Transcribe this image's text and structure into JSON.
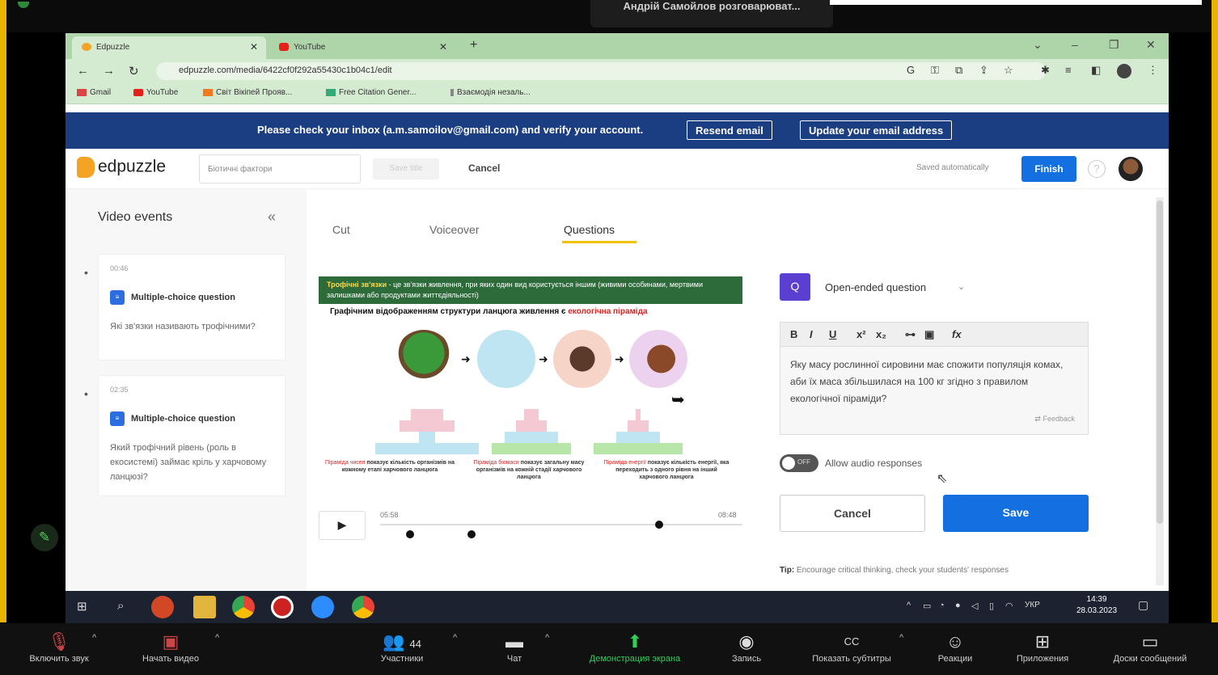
{
  "zoom_top": {
    "speaker": "Андрій Самойлов розговарюват..."
  },
  "browser": {
    "tabs": [
      {
        "label": "Edpuzzle"
      },
      {
        "label": "YouTube"
      }
    ],
    "url": "edpuzzle.com/media/6422cf0f292a55430c1b04c1/edit",
    "bookmarks": [
      "Gmail",
      "YouTube",
      "Світ Вікіпей Прояв...",
      "Free Citation Gener...",
      "Взаємодія незаль..."
    ]
  },
  "verify": {
    "text": "Please check your inbox (a.m.samoilov@gmail.com) and verify your account.",
    "resend": "Resend email",
    "update": "Update your email address"
  },
  "header": {
    "logo": "edpuzzle",
    "title_value": "Біотичні фактори",
    "save_title": "Save title",
    "cancel": "Cancel",
    "saved_auto": "Saved automatically",
    "finish": "Finish",
    "help": "?"
  },
  "sidebar": {
    "title": "Video events",
    "events": [
      {
        "time": "00:46",
        "type": "Multiple-choice question",
        "question": "Які зв'язки називають трофічними?"
      },
      {
        "time": "02:35",
        "type": "Multiple-choice question",
        "question": "Який трофічний рівень (роль в екосистемі) займає кріль у харчовому ланцюзі?"
      }
    ]
  },
  "tabs": {
    "cut": "Cut",
    "voiceover": "Voiceover",
    "questions": "Questions"
  },
  "video": {
    "banner_bold": "Трофічні зв'язки",
    "banner_rest": " - це зв'язки живлення, при яких один вид користується іншим (живими особинами, мертвими залишками або продуктами життєдіяльності)",
    "subtitle_a": "Графічним відображенням структури ланцюга живлення є ",
    "subtitle_b": "екологічна піраміда",
    "pyr1_a": "Піраміда чисел",
    "pyr1_b": " показує кількість організмів на кожному етапі харчового ланцюга",
    "pyr2_a": "Піраміда біомаси",
    "pyr2_b": " показує загальну масу організмів на кожній стадії харчового ланцюга",
    "pyr3_a": "Піраміда енергії",
    "pyr3_b": " показує кількість енергії, яка переходить з одного рівня на інший харчового ланцюга",
    "time_current": "05:58",
    "time_total": "08:48",
    "progress": 0.77
  },
  "question": {
    "icon": "Q",
    "type": "Open-ended question",
    "text": "Яку масу рослинної сировини має спожити популяція комах, аби їх маса збільшилася на 100 кг згідно з правилом екологічної піраміди?",
    "feedback": "Feedback",
    "toggle_state": "OFF",
    "allow_audio": "Allow audio responses",
    "cancel": "Cancel",
    "save": "Save",
    "tip_label": "Tip:",
    "tip_text": " Encourage critical thinking, check your students' responses"
  },
  "taskbar": {
    "lang": "УКР",
    "time": "14:39",
    "date": "28.03.2023"
  },
  "zoom_controls": [
    {
      "label": "Включить звук",
      "icon": "mic-muted-icon"
    },
    {
      "label": "Начать видео",
      "icon": "video-off-icon"
    },
    {
      "label": "Участники",
      "icon": "participants-icon",
      "count": "44"
    },
    {
      "label": "Чат",
      "icon": "chat-icon"
    },
    {
      "label": "Демонстрация экрана",
      "icon": "share-screen-icon"
    },
    {
      "label": "Запись",
      "icon": "record-icon"
    },
    {
      "label": "Показать субтитры",
      "icon": "cc-icon"
    },
    {
      "label": "Реакции",
      "icon": "reactions-icon"
    },
    {
      "label": "Приложения",
      "icon": "apps-icon"
    },
    {
      "label": "Доски сообщений",
      "icon": "whiteboard-icon"
    }
  ],
  "colors": {
    "edpuzzle_blue": "#1470e0",
    "verify_bar": "#1b3e82",
    "zoom_green": "#2fd05a",
    "question_purple": "#5b3fd0"
  }
}
